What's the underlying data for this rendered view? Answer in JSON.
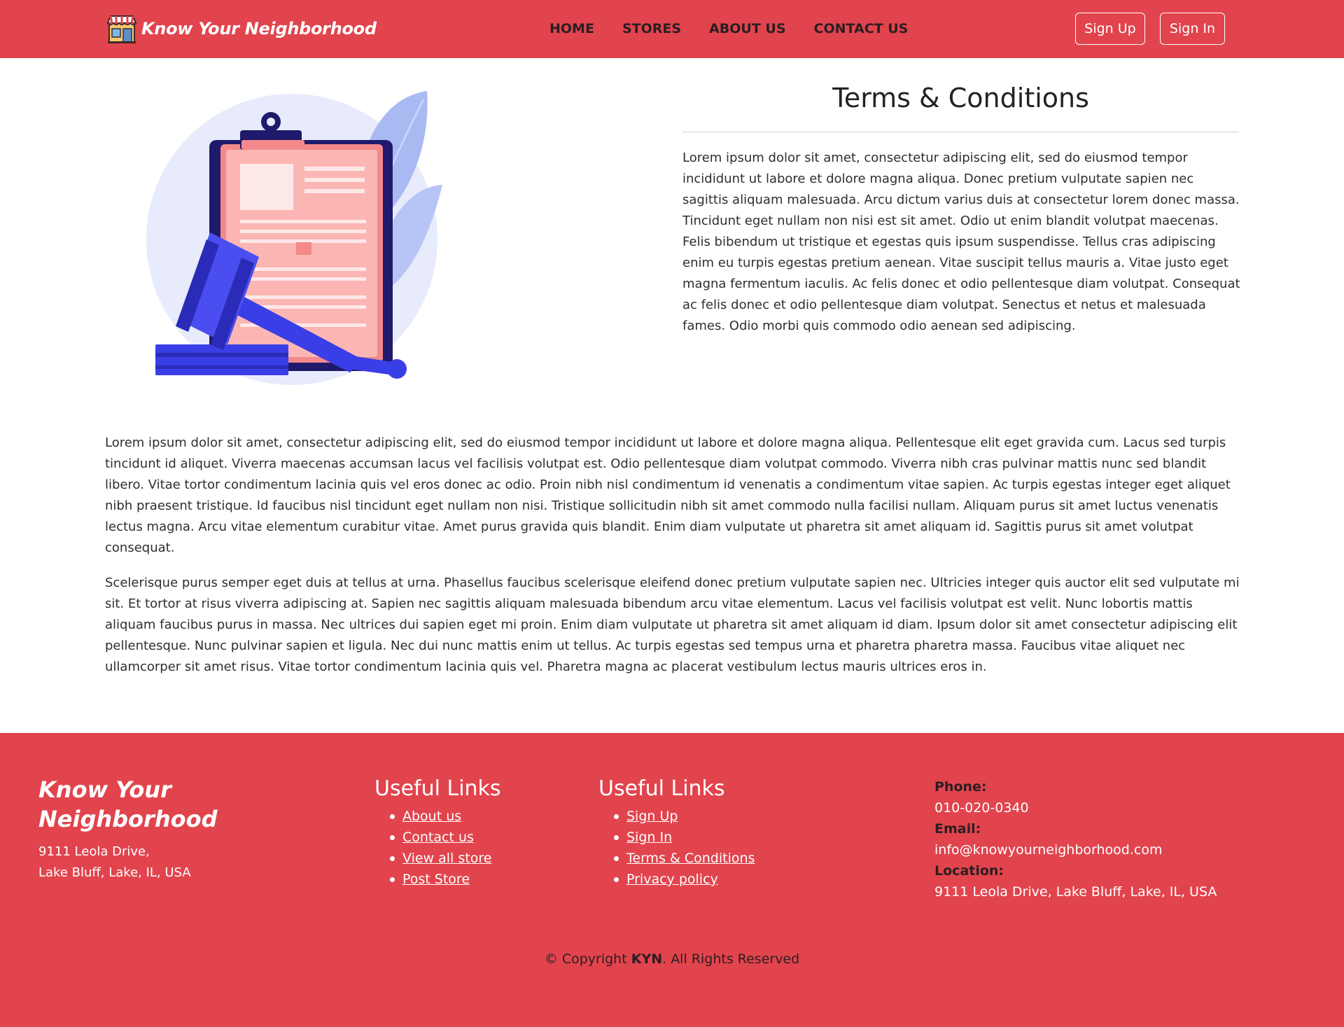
{
  "colors": {
    "brand_red": "#e1444d",
    "text_dark": "#212529",
    "white": "#ffffff"
  },
  "navbar": {
    "brand_text": "Know Your Neighborhood",
    "logo_icon": "storefront-icon",
    "links": [
      "HOME",
      "STORES",
      "ABOUT US",
      "CONTACT US"
    ],
    "sign_up": "Sign Up",
    "sign_in": "Sign In"
  },
  "hero": {
    "illustration": "clipboard-gavel-illustration",
    "title": "Terms & Conditions",
    "intro": "Lorem ipsum dolor sit amet, consectetur adipiscing elit, sed do eiusmod tempor incididunt ut labore et dolore magna aliqua. Donec pretium vulputate sapien nec sagittis aliquam malesuada. Arcu dictum varius duis at consectetur lorem donec massa. Tincidunt eget nullam non nisi est sit amet. Odio ut enim blandit volutpat maecenas. Felis bibendum ut tristique et egestas quis ipsum suspendisse. Tellus cras adipiscing enim eu turpis egestas pretium aenean. Vitae suscipit tellus mauris a. Vitae justo eget magna fermentum iaculis. Ac felis donec et odio pellentesque diam volutpat. Consequat ac felis donec et odio pellentesque diam volutpat. Senectus et netus et malesuada fames. Odio morbi quis commodo odio aenean sed adipiscing."
  },
  "paragraphs": [
    "Lorem ipsum dolor sit amet, consectetur adipiscing elit, sed do eiusmod tempor incididunt ut labore et dolore magna aliqua. Pellentesque elit eget gravida cum. Lacus sed turpis tincidunt id aliquet. Viverra maecenas accumsan lacus vel facilisis volutpat est. Odio pellentesque diam volutpat commodo. Viverra nibh cras pulvinar mattis nunc sed blandit libero. Vitae tortor condimentum lacinia quis vel eros donec ac odio. Proin nibh nisl condimentum id venenatis a condimentum vitae sapien. Ac turpis egestas integer eget aliquet nibh praesent tristique. Id faucibus nisl tincidunt eget nullam non nisi. Tristique sollicitudin nibh sit amet commodo nulla facilisi nullam. Aliquam purus sit amet luctus venenatis lectus magna. Arcu vitae elementum curabitur vitae. Amet purus gravida quis blandit. Enim diam vulputate ut pharetra sit amet aliquam id. Sagittis purus sit amet volutpat consequat.",
    "Scelerisque purus semper eget duis at tellus at urna. Phasellus faucibus scelerisque eleifend donec pretium vulputate sapien nec. Ultricies integer quis auctor elit sed vulputate mi sit. Et tortor at risus viverra adipiscing at. Sapien nec sagittis aliquam malesuada bibendum arcu vitae elementum. Lacus vel facilisis volutpat est velit. Nunc lobortis mattis aliquam faucibus purus in massa. Nec ultrices dui sapien eget mi proin. Enim diam vulputate ut pharetra sit amet aliquam id diam. Ipsum dolor sit amet consectetur adipiscing elit pellentesque. Nunc pulvinar sapien et ligula. Nec dui nunc mattis enim ut tellus. Ac turpis egestas sed tempus urna et pharetra pharetra massa. Faucibus vitae aliquet nec ullamcorper sit amet risus. Vitae tortor condimentum lacinia quis vel. Pharetra magna ac placerat vestibulum lectus mauris ultrices eros in."
  ],
  "footer": {
    "brand": "Know Your Neighborhood",
    "address_line1": "9111 Leola Drive,",
    "address_line2": "Lake Bluff, Lake, IL, USA",
    "col1": {
      "heading": "Useful Links",
      "links": [
        "About us",
        "Contact us",
        "View all store",
        "Post Store"
      ]
    },
    "col2": {
      "heading": "Useful Links",
      "links": [
        "Sign Up",
        "Sign In",
        "Terms & Conditions",
        "Privacy policy"
      ]
    },
    "contact": {
      "phone_label": "Phone:",
      "phone": "010-020-0340",
      "email_label": "Email:",
      "email": "info@knowyourneighborhood.com",
      "location_label": "Location:",
      "location": "9111 Leola Drive, Lake Bluff, Lake, IL, USA"
    },
    "copyright_prefix": "© Copyright ",
    "copyright_brand": "KYN",
    "copyright_suffix": ". All Rights Reserved"
  }
}
